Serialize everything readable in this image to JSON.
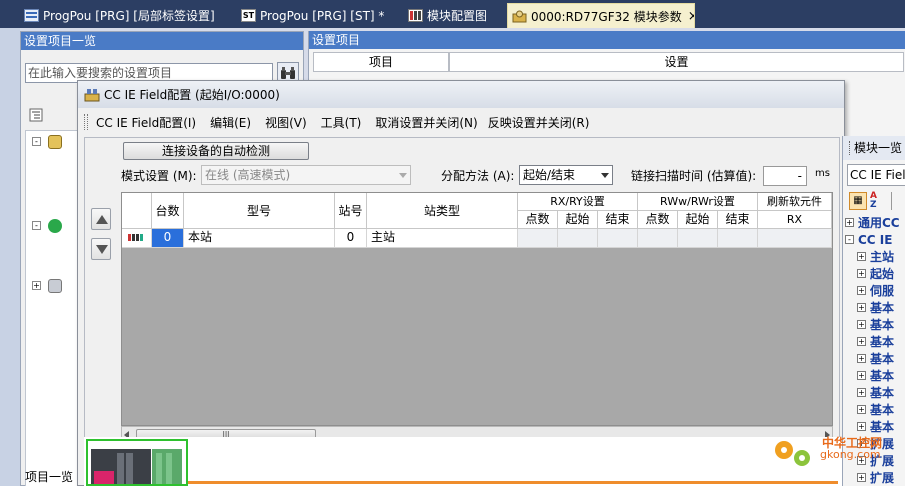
{
  "tabs": [
    {
      "label": "ProgPou [PRG] [局部标签设置]",
      "icon": "program-icon",
      "active": false
    },
    {
      "label": "ProgPou [PRG] [ST] *",
      "icon": "st-icon",
      "active": false
    },
    {
      "label": "模块配置图",
      "icon": "module-config-icon",
      "active": false
    },
    {
      "label": "0000:RD77GF32 模块参数",
      "icon": "parameter-icon",
      "active": true,
      "close": "×"
    }
  ],
  "left_panel": {
    "title": "设置项目一览",
    "search_placeholder": "在此输入要搜索的设置项目",
    "bottom_label": "项目一览"
  },
  "setting_panel": {
    "title": "设置项目",
    "columns": [
      "项目",
      "设置"
    ]
  },
  "dialog": {
    "title": "CC IE Field配置 (起始I/O:0000)",
    "menu": [
      "CC IE Field配置(I)",
      "编辑(E)",
      "视图(V)",
      "工具(T)",
      "取消设置并关闭(N)",
      "反映设置并关闭(R)"
    ],
    "auto_detect_button": "连接设备的自动检测",
    "mode_label": "模式设置 (M):",
    "mode_value": "在线 (高速模式)",
    "assign_label": "分配方法 (A):",
    "assign_value": "起始/结束",
    "scan_label": "链接扫描时间 (估算值):",
    "scan_value": "-",
    "scan_unit": "ms"
  },
  "grid": {
    "headers": {
      "count": "台数",
      "model": "型号",
      "station_no": "站号",
      "station_type": "站类型",
      "rxry": "RX/RY设置",
      "rwwrwr": "RWw/RWr设置",
      "refresh": "刷新软元件",
      "points": "点数",
      "start": "起始",
      "end": "结束",
      "rx": "RX"
    },
    "rows": [
      {
        "count": "0",
        "model": "本站",
        "station_no": "0",
        "station_type": "主站"
      }
    ],
    "scroll_thumb": "III"
  },
  "module_panel": {
    "title": "模块一览",
    "search_text": "CC IE Field",
    "items": [
      {
        "expander": "+",
        "label": "通用CC"
      },
      {
        "expander": "-",
        "label": "CC IE"
      },
      {
        "expander": "+",
        "label": "主站"
      },
      {
        "expander": "+",
        "label": "起始"
      },
      {
        "expander": "+",
        "label": "伺服"
      },
      {
        "expander": "+",
        "label": "基本"
      },
      {
        "expander": "+",
        "label": "基本"
      },
      {
        "expander": "+",
        "label": "基本"
      },
      {
        "expander": "+",
        "label": "基本"
      },
      {
        "expander": "+",
        "label": "基本"
      },
      {
        "expander": "+",
        "label": "基本"
      },
      {
        "expander": "+",
        "label": "基本"
      },
      {
        "expander": "+",
        "label": "基本"
      },
      {
        "expander": "+",
        "label": "扩展"
      },
      {
        "expander": "+",
        "label": "扩展"
      },
      {
        "expander": "+",
        "label": "扩展"
      }
    ]
  },
  "watermark": {
    "text1": "中华工控网",
    "text2": "gkong.com"
  },
  "colors": {
    "tab_bar": "#2c3e63",
    "active_tab": "#f5f0cf",
    "panel_header": "#4a7bc6",
    "grid_bg": "#a8a8a8",
    "tree_text": "#1a3f9b",
    "highlight_cell": "#2a6fdb",
    "plc_border": "#2ec12e",
    "orange_line": "#ef8d2c"
  }
}
